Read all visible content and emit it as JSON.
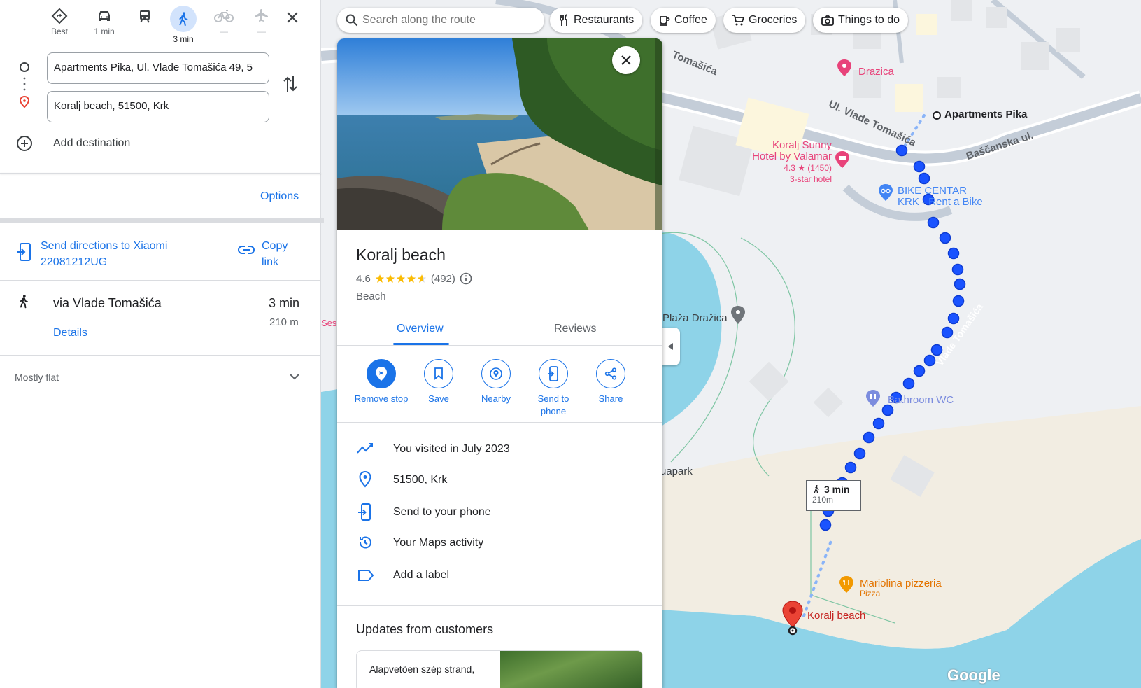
{
  "travel_modes": [
    {
      "name": "Best",
      "label": "Best",
      "icon": "directions-diamond-icon"
    },
    {
      "name": "driving",
      "label": "1 min",
      "icon": "car-icon"
    },
    {
      "name": "transit",
      "label": "",
      "icon": "train-icon"
    },
    {
      "name": "walking",
      "label": "3 min",
      "icon": "walking-icon",
      "selected": true
    },
    {
      "name": "cycling",
      "label": "—",
      "icon": "bicycle-icon"
    },
    {
      "name": "flights",
      "label": "—",
      "icon": "plane-icon"
    }
  ],
  "origin": {
    "value": "Apartments Pika, Ul. Vlade Tomašića 49, 5"
  },
  "destination": {
    "value": "Koralj beach, 51500, Krk"
  },
  "add_destination": "Add destination",
  "options_label": "Options",
  "send_directions": {
    "line1": "Send directions to Xiaomi",
    "line2": "22081212UG"
  },
  "copy_link": {
    "line1": "Copy",
    "line2": "link"
  },
  "route": {
    "via": "via Vlade Tomašića",
    "time": "3 min",
    "distance": "210 m",
    "details": "Details"
  },
  "terrain": "Mostly flat",
  "search": {
    "placeholder": "Search along the route"
  },
  "chips": [
    "Restaurants",
    "Coffee",
    "Groceries",
    "Things to do"
  ],
  "place": {
    "name": "Koralj beach",
    "rating": "4.6",
    "stars": 4.6,
    "reviews_count": "(492)",
    "category": "Beach",
    "tabs": [
      "Overview",
      "Reviews"
    ],
    "actions": [
      {
        "label": "Remove stop",
        "icon": "remove-stop-icon"
      },
      {
        "label": "Save",
        "icon": "bookmark-icon"
      },
      {
        "label": "Nearby",
        "icon": "nearby-icon"
      },
      {
        "label": "Send to phone",
        "icon": "send-to-phone-icon"
      },
      {
        "label": "Share",
        "icon": "share-icon"
      }
    ],
    "info_rows": [
      {
        "text": "You visited in July 2023",
        "icon": "visited-trend-icon"
      },
      {
        "text": "51500, Krk",
        "icon": "location-pin-icon"
      },
      {
        "text": "Send to your phone",
        "icon": "phone-send-icon"
      },
      {
        "text": "Your Maps activity",
        "icon": "history-icon"
      },
      {
        "text": "Add a label",
        "icon": "label-icon"
      }
    ],
    "updates_heading": "Updates from customers",
    "update_snippet": "Alapvetően szép strand,"
  },
  "map_labels": {
    "street_1": "Tomašića",
    "street_2": "Ul. Vlade Tomašića",
    "street_3": "Baščanska ul.",
    "street_4": "Vlade Tomašića",
    "drazica": "Drazica",
    "apartments": "Apartments Pika",
    "hotel_line1": "Koralj Sunny",
    "hotel_line2": "Hotel by Valamar",
    "hotel_rating": "4.3 ★ (1450)",
    "hotel_class": "3-star hotel",
    "bike_line1": "BIKE CENTAR",
    "bike_line2": "KRK - Rent a Bike",
    "plaza": "Plaža Dražica",
    "bathroom": "Bathroom WC",
    "aquapark": "uapark",
    "sesa": "Sesa",
    "route_time": "3 min",
    "route_dist": "210m",
    "pizzeria": "Mariolina pizzeria",
    "pizza_cat": "Pizza",
    "koralj": "Koralj beach",
    "google": "Google"
  },
  "colors": {
    "accent": "#1a73e8",
    "route": "#1a53ff",
    "pin": "#ea4335",
    "water": "#8ed3e8",
    "sand": "#f2ede2",
    "hotel_pink": "#e8437a"
  }
}
